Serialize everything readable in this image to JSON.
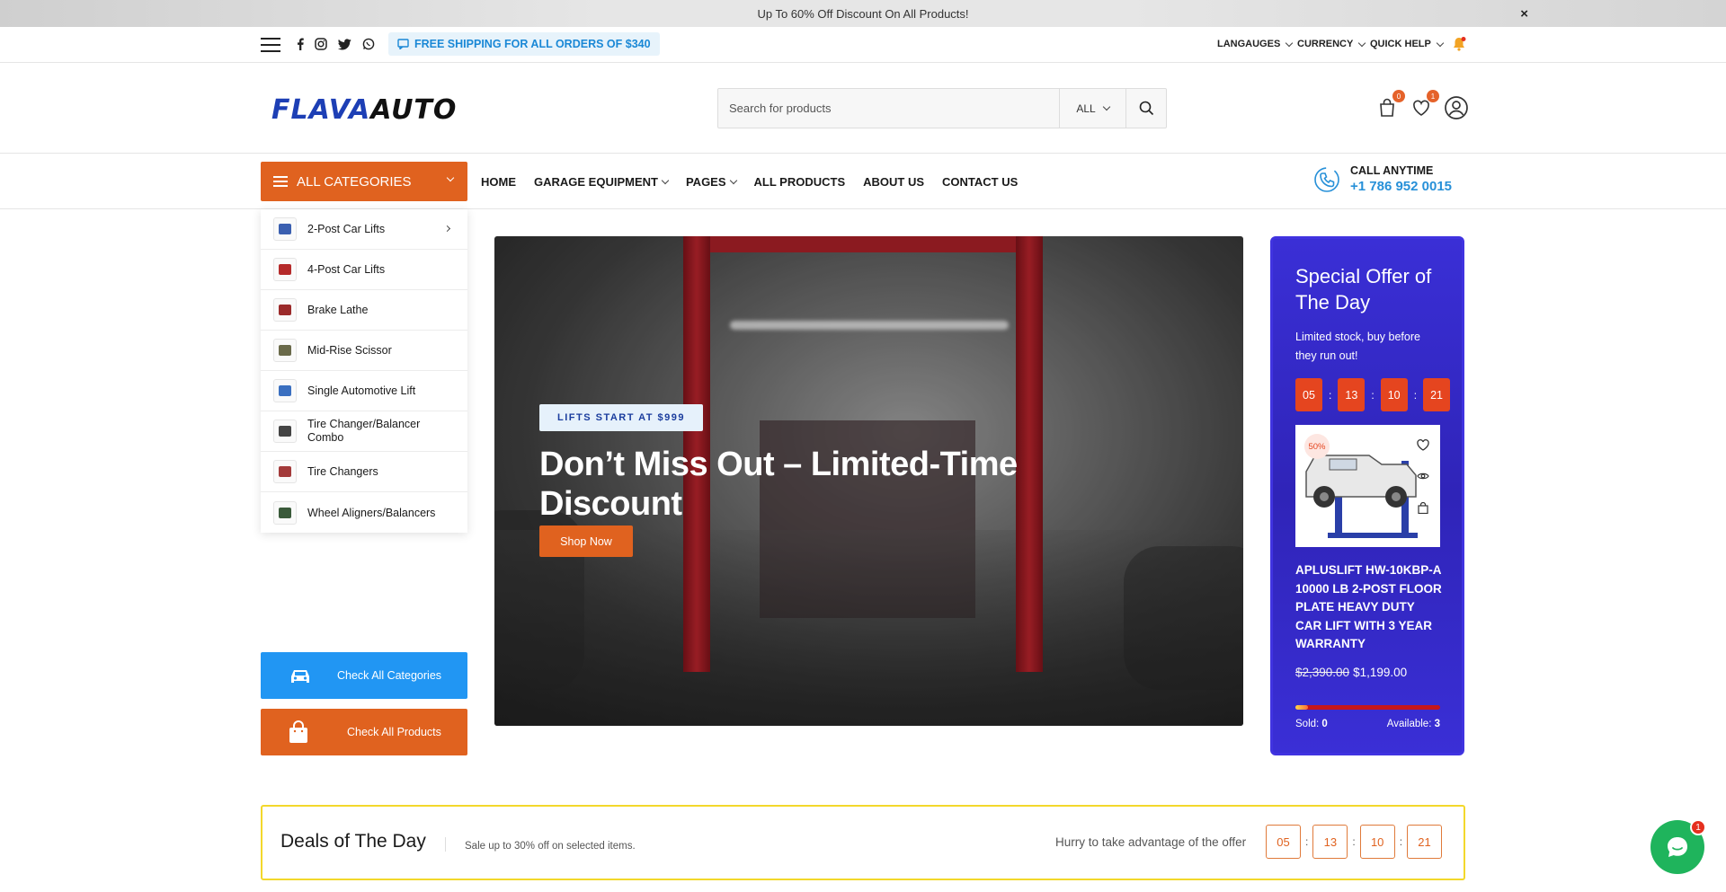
{
  "promo": {
    "text": "Up To 60% Off Discount On All Products!",
    "close": "×"
  },
  "utility": {
    "shipping": "FREE SHIPPING FOR ALL ORDERS OF $340",
    "languages": "LANGAUGES",
    "currency": "CURRENCY",
    "quick_help": "QUICK HELP",
    "social_icons": [
      "facebook-icon",
      "instagram-icon",
      "twitter-icon",
      "whatsapp-icon"
    ]
  },
  "header": {
    "logo_part1": "FLAVA",
    "logo_part2": "AUTO",
    "search_placeholder": "Search for products",
    "search_category": "ALL",
    "cart_count": "0",
    "wishlist_count": "1"
  },
  "nav": {
    "all_categories": "ALL CATEGORIES",
    "links": [
      "HOME",
      "GARAGE EQUIPMENT",
      "PAGES",
      "ALL PRODUCTS",
      "ABOUT US",
      "CONTACT US"
    ],
    "call_label": "CALL ANYTIME",
    "call_number": "+1 786 952 0015"
  },
  "categories": [
    {
      "label": "2-Post Car Lifts",
      "color": "#3a5fb0"
    },
    {
      "label": "4-Post Car Lifts",
      "color": "#b52a2a"
    },
    {
      "label": "Brake Lathe",
      "color": "#9b2a2a"
    },
    {
      "label": "Mid-Rise Scissor",
      "color": "#6a6a4a"
    },
    {
      "label": "Single Automotive Lift",
      "color": "#3a6fc0"
    },
    {
      "label": "Tire Changer/Balancer Combo",
      "color": "#444444"
    },
    {
      "label": "Tire Changers",
      "color": "#a33a3a"
    },
    {
      "label": "Wheel Aligners/Balancers",
      "color": "#3a5a3a"
    }
  ],
  "side_buttons": {
    "categories": "Check All Categories",
    "products": "Check All Products"
  },
  "hero": {
    "tag": "LIFTS START AT $999",
    "headline": "Don’t Miss Out – Limited-Time Discount",
    "cta": "Shop Now"
  },
  "special_offer": {
    "title": "Special Offer of The Day",
    "subtitle": "Limited stock, buy before they run out!",
    "countdown": [
      "05",
      "13",
      "10",
      "21"
    ],
    "discount": "50%",
    "product_name": "APLUSLIFT HW-10KBP-A 10000 LB 2-POST FLOOR PLATE HEAVY DUTY CAR LIFT WITH 3 YEAR WARRANTY",
    "old_price": "$2,390.00",
    "new_price": "$1,199.00",
    "sold_label": "Sold:",
    "sold": "0",
    "available_label": "Available:",
    "available": "3",
    "sold_fraction": 0.0
  },
  "deals": {
    "title": "Deals of The Day",
    "subtitle": "Sale up to 30% off on selected items.",
    "hurry": "Hurry to take advantage of the offer",
    "countdown": [
      "05",
      "13",
      "10",
      "21"
    ]
  },
  "chat": {
    "badge": "1"
  },
  "colors": {
    "accent": "#e0621f",
    "blue": "#2790d8",
    "offer_bg": "#3a2fd6",
    "deals_border": "#f3d82b"
  }
}
